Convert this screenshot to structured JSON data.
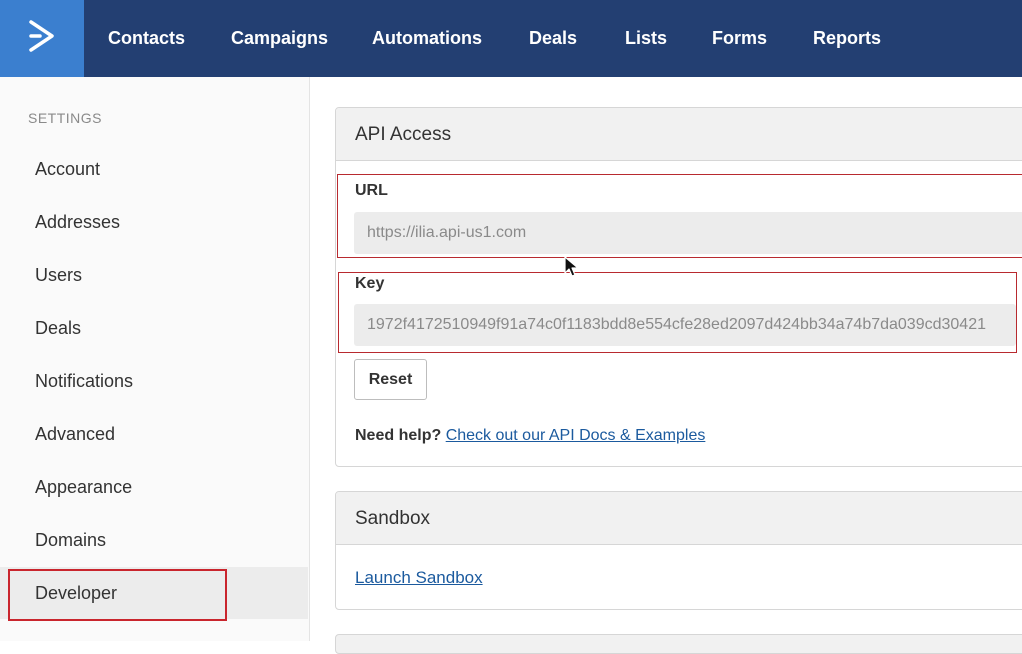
{
  "nav": {
    "items": [
      {
        "label": "Contacts",
        "name": "nav-contacts"
      },
      {
        "label": "Campaigns",
        "name": "nav-campaigns"
      },
      {
        "label": "Automations",
        "name": "nav-automations"
      },
      {
        "label": "Deals",
        "name": "nav-deals"
      },
      {
        "label": "Lists",
        "name": "nav-lists"
      },
      {
        "label": "Forms",
        "name": "nav-forms"
      },
      {
        "label": "Reports",
        "name": "nav-reports"
      }
    ]
  },
  "sidebar": {
    "heading": "SETTINGS",
    "items": [
      {
        "label": "Account"
      },
      {
        "label": "Addresses"
      },
      {
        "label": "Users"
      },
      {
        "label": "Deals"
      },
      {
        "label": "Notifications"
      },
      {
        "label": "Advanced"
      },
      {
        "label": "Appearance"
      },
      {
        "label": "Domains"
      },
      {
        "label": "Developer"
      }
    ],
    "active": "Developer"
  },
  "api_access": {
    "title": "API Access",
    "url_label": "URL",
    "url_value": "https://ilia.api-us1.com",
    "key_label": "Key",
    "key_value": "1972f4172510949f91a74c0f1183bdd8e554cfe28ed2097d424bb34a74b7da039cd30421",
    "reset_label": "Reset",
    "help_prefix": "Need help?",
    "help_link": "Check out our API Docs & Examples"
  },
  "sandbox": {
    "title": "Sandbox",
    "launch_link": "Launch Sandbox"
  },
  "colors": {
    "topbar": "#233f72",
    "logo_bg": "#3b7fcf",
    "highlight": "#c9252d",
    "link": "#1b5a9e"
  }
}
